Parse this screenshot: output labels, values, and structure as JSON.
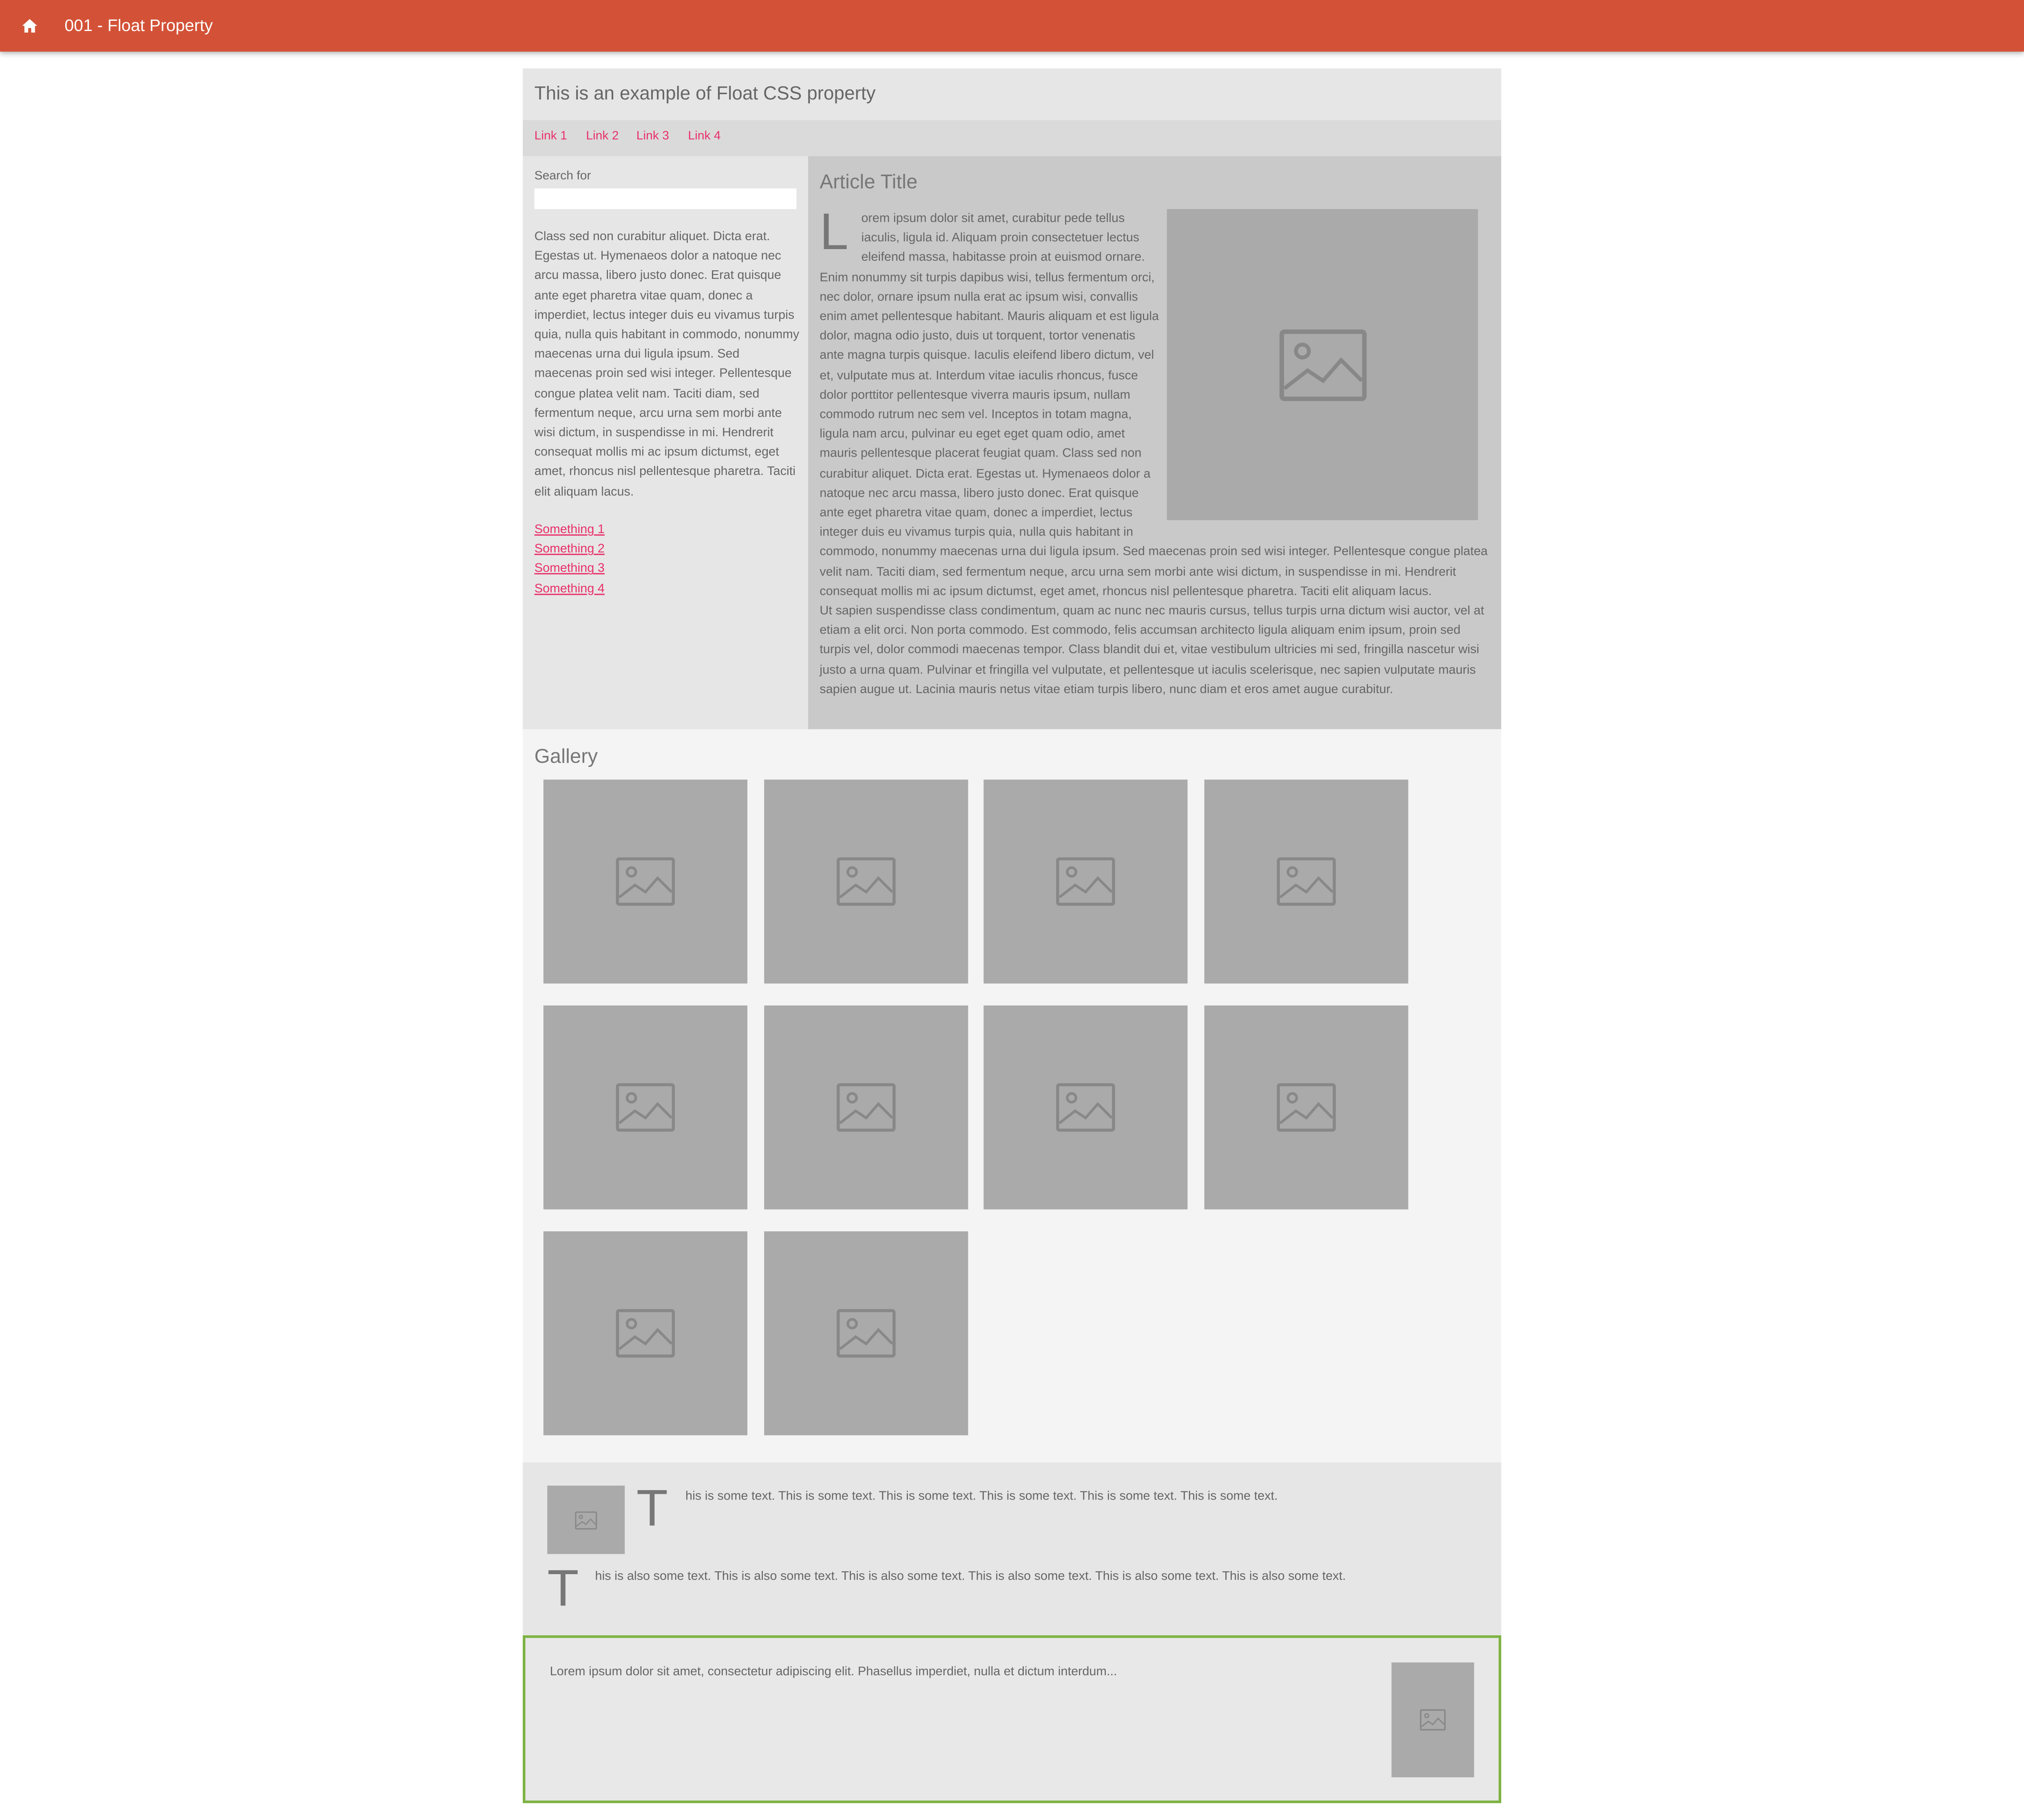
{
  "appbar": {
    "title": "001 - Float Property",
    "home_icon": "home-icon"
  },
  "header": {
    "title": "This is an example of Float CSS property"
  },
  "nav": {
    "links": [
      "Link 1",
      "Link 2",
      "Link 3",
      "Link 4"
    ]
  },
  "sidebar": {
    "search_label": "Search for",
    "search_value": "",
    "text": "Class sed non curabitur aliquet. Dicta erat. Egestas ut. Hymenaeos dolor a natoque nec arcu massa, libero justo donec. Erat quisque ante eget pharetra vitae quam, donec a imperdiet, lectus integer duis eu vivamus turpis quia, nulla quis habitant in commodo, nonummy maecenas urna dui ligula ipsum. Sed maecenas proin sed wisi integer. Pellentesque congue platea velit nam. Taciti diam, sed fermentum neque, arcu urna sem morbi ante wisi dictum, in suspendisse in mi. Hendrerit consequat mollis mi ac ipsum dictumst, eget amet, rhoncus nisl pellentesque pharetra. Taciti elit aliquam lacus.",
    "links": [
      "Something 1",
      "Something 2",
      "Something 3",
      "Something 4"
    ]
  },
  "article": {
    "title": "Article Title",
    "dropcap": "L",
    "paragraph1": "orem ipsum dolor sit amet, curabitur pede tellus iaculis, ligula id. Aliquam proin consectetuer lectus eleifend massa, habitasse proin at euismod ornare. Enim nonummy sit turpis dapibus wisi, tellus fermentum orci, nec dolor, ornare ipsum nulla erat ac ipsum wisi, convallis enim amet pellentesque habitant. Mauris aliquam et est ligula dolor, magna odio justo, duis ut torquent, tortor venenatis ante magna turpis quisque. Iaculis eleifend libero dictum, vel et, vulputate mus at. Interdum vitae iaculis rhoncus, fusce dolor porttitor pellentesque viverra mauris ipsum, nullam commodo rutrum nec sem vel. Inceptos in totam magna, ligula nam arcu, pulvinar eu eget eget quam odio, amet mauris pellentesque placerat feugiat quam. Class sed non curabitur aliquet. Dicta erat. Egestas ut. Hymenaeos dolor a natoque nec arcu massa, libero justo donec. Erat quisque ante eget pharetra vitae quam, donec a imperdiet, lectus integer duis eu vivamus turpis quia, nulla quis habitant in commodo, nonummy maecenas urna dui ligula ipsum. Sed maecenas proin sed wisi integer. Pellentesque congue platea velit nam. Taciti diam, sed fermentum neque, arcu urna sem morbi ante wisi dictum, in suspendisse in mi. Hendrerit consequat mollis mi ac ipsum dictumst, eget amet, rhoncus nisl pellentesque pharetra. Taciti elit aliquam lacus.",
    "paragraph2": "Ut sapien suspendisse class condimentum, quam ac nunc nec mauris cursus, tellus turpis urna dictum wisi auctor, vel at etiam a elit orci. Non porta commodo. Est commodo, felis accumsan architecto ligula aliquam enim ipsum, proin sed turpis vel, dolor commodi maecenas tempor. Class blandit dui et, vitae vestibulum ultricies mi sed, fringilla nascetur wisi justo a urna quam. Pulvinar et fringilla vel vulputate, et pellentesque ut iaculis scelerisque, nec sapien vulputate mauris sapien augue ut. Lacinia mauris netus vitae etiam turpis libero, nunc diam et eros amet augue curabitur."
  },
  "gallery": {
    "title": "Gallery",
    "image_count": 10
  },
  "text_section": {
    "line1_initial": "T",
    "line1_rest": "his is some text. This is some text. This is some text. This is some text. This is some text. This is some text.",
    "line2_initial": "T",
    "line2_rest": "his is also some text. This is also some text. This is also some text. This is also some text. This is also some text. This is also some text."
  },
  "bottom_box": {
    "text": "Lorem ipsum dolor sit amet, consectetur adipiscing elit. Phasellus imperdiet, nulla et dictum interdum..."
  },
  "colors": {
    "appbar": "#d35237",
    "link": "#e8306a",
    "placeholder": "#aaaaaa",
    "bottom_border": "#7db241"
  }
}
